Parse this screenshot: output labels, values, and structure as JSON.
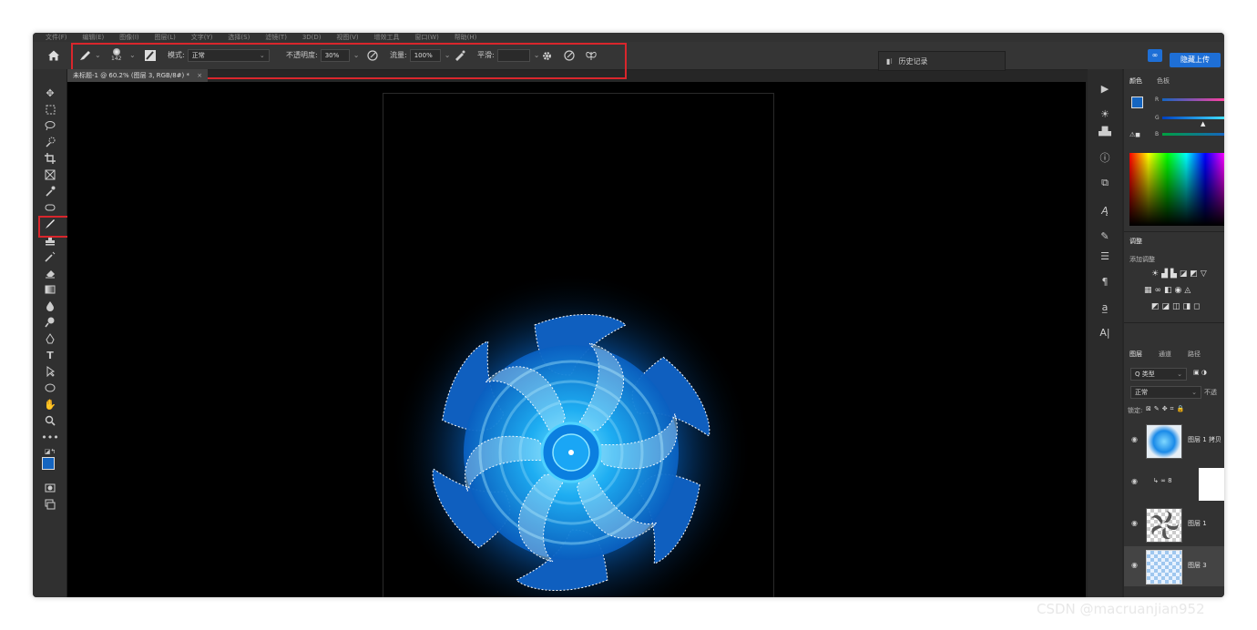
{
  "menu": {
    "items": [
      "文件(F)",
      "编辑(E)",
      "图像(I)",
      "图层(L)",
      "文字(Y)",
      "选择(S)",
      "滤镜(T)",
      "3D(D)",
      "视图(V)",
      "增效工具",
      "窗口(W)",
      "帮助(H)"
    ]
  },
  "options": {
    "brush_size": "142",
    "mode_label": "模式:",
    "mode_value": "正常",
    "opacity_label": "不透明度:",
    "opacity_value": "30%",
    "flow_label": "流量:",
    "flow_value": "100%",
    "smoothing_label": "平滑:",
    "smoothing_value": ""
  },
  "document_tab": {
    "label": "未标题-1 @ 60.2% (图层 3, RGB/8#) *",
    "close": "×"
  },
  "history": {
    "label": "历史记录"
  },
  "upload_button": "隐藏上传",
  "panels": {
    "color_tab": "颜色",
    "swatches_tab": "色板",
    "channel_r": "R",
    "channel_g": "G",
    "channel_b": "B",
    "adjust_tab": "调整",
    "adjust_add": "添加调整",
    "layers_tab": "图层",
    "channels_tab": "通道",
    "paths_tab": "路径",
    "kind_filter": "Q 类型",
    "blend_mode": "正常",
    "opacity_short": "不透",
    "lock_label": "锁定:"
  },
  "layers": [
    {
      "name": "图层 1 拷贝"
    },
    {
      "name": ""
    },
    {
      "name": "图层 1"
    },
    {
      "name": "图层 3"
    }
  ],
  "colors": {
    "accent": "#1e6fd6",
    "foreground": "#1565c0",
    "highlight": "#d9262c"
  },
  "watermark": "CSDN @macruanjian952"
}
